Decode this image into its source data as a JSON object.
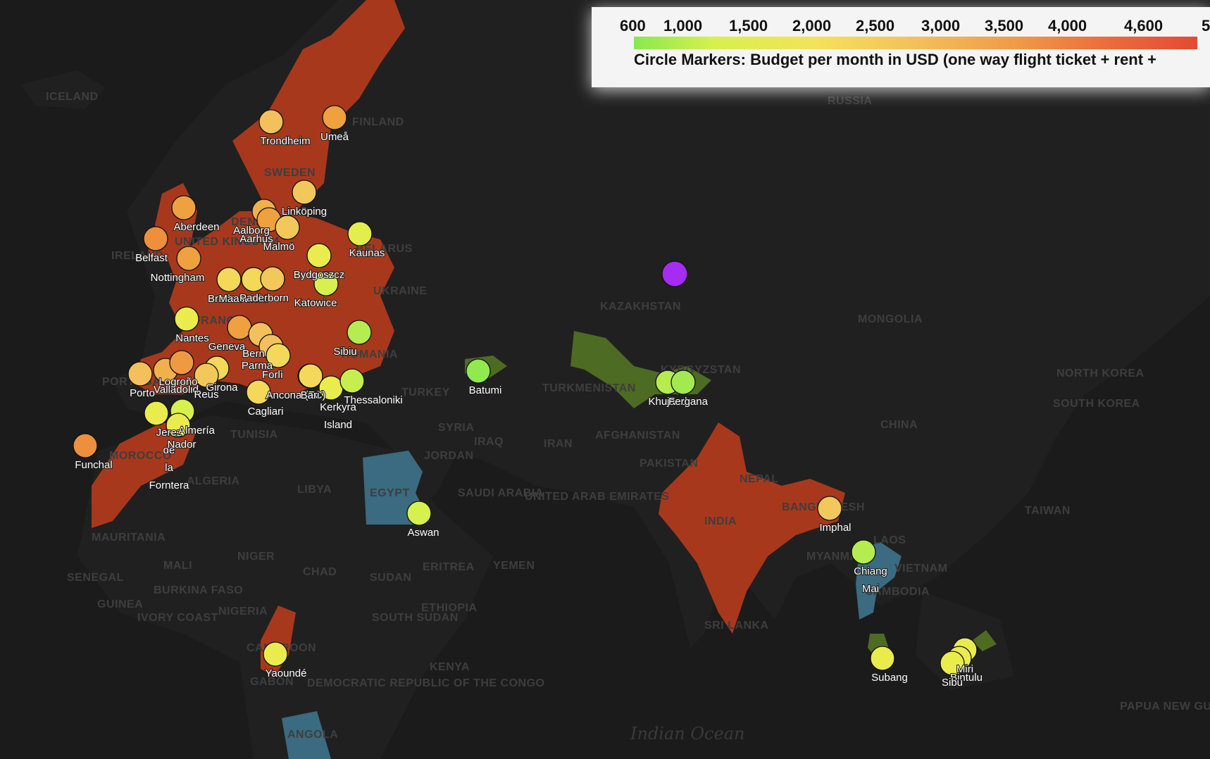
{
  "colors": {
    "background": "#1b1b1b",
    "land": "#1e1e1e",
    "high_budget_region": "#a8381c",
    "low_budget_region": "#4d6b22",
    "blue_region": "#3a6b80",
    "marker_green": "#92e94f",
    "marker_yellow": "#eaec4d",
    "marker_lightyellow": "#f3e35a",
    "marker_orange": "#efa13f",
    "marker_purple": "#a52cf0"
  },
  "legend": {
    "ticks": [
      "600",
      "1,000",
      "1,500",
      "2,000",
      "2,500",
      "3,000",
      "3,500",
      "4,000",
      "4,600",
      "5"
    ],
    "title": "Circle Markers: Budget per month in USD (one way flight ticket + rent +"
  },
  "countries": [
    "ICELAND",
    "FINLAND",
    "SWEDEN",
    "DENMARK",
    "IRELAND",
    "UNITED KINGDOM",
    "BELARUS",
    "UKRAINE",
    "FRANCE",
    "PORTUGAL",
    "ROMANIA",
    "TURKEY",
    "SYRIA",
    "IRAQ",
    "JORDAN",
    "IRAN",
    "TURKMENISTAN",
    "AFGHANISTAN",
    "PAKISTAN",
    "KAZAKHSTAN",
    "KYRGYZSTAN",
    "MONGOLIA",
    "CHINA",
    "RUSSIA",
    "NORTH KOREA",
    "SOUTH KOREA",
    "TAIWAN",
    "INDIA",
    "NEPAL",
    "BANGLADESH",
    "SRI LANKA",
    "MYANMAR",
    "LAOS",
    "VIETNAM",
    "CAMBODIA",
    "TUNISIA",
    "ALGERIA",
    "LIBYA",
    "EGYPT",
    "SAUDI ARABIA",
    "UNITED ARAB EMIRATES",
    "YEMEN",
    "ERITREA",
    "SUDAN",
    "SOUTH SUDAN",
    "ETHIOPIA",
    "KENYA",
    "CHAD",
    "NIGER",
    "MALI",
    "MAURITANIA",
    "SENEGAL",
    "GUINEA",
    "BURKINA FASO",
    "IVORY COAST",
    "NIGERIA",
    "CAMEROON",
    "GABON",
    "DEMOCRATIC REPUBLIC OF THE CONGO",
    "ANGOLA",
    "MOROCCO",
    "PAPUA NEW GUINEA"
  ],
  "seas": [
    "Indian Ocean"
  ],
  "cities": [
    {
      "name": "Trondheim",
      "color": "#f3c05c"
    },
    {
      "name": "Umeå",
      "color": "#efa13f"
    },
    {
      "name": "Linköping",
      "color": "#f3c85a"
    },
    {
      "name": "Aberdeen",
      "color": "#efa13f"
    },
    {
      "name": "Belfast",
      "color": "#ee8f3d"
    },
    {
      "name": "Aalborg",
      "color": "#f0b04c"
    },
    {
      "name": "Aarhus",
      "color": "#efa13f"
    },
    {
      "name": "Malmö",
      "color": "#f3c85a"
    },
    {
      "name": "Kaunas",
      "color": "#e3ee4d"
    },
    {
      "name": "Bydgoszcz",
      "color": "#eaec4d"
    },
    {
      "name": "Nottingham",
      "color": "#efa13f"
    },
    {
      "name": "Breda",
      "color": "#f3d85a"
    },
    {
      "name": "Maastricht",
      "color": "#f3d85a"
    },
    {
      "name": "Paderborn",
      "color": "#f3c85a"
    },
    {
      "name": "Katowice",
      "color": "#d6f04e"
    },
    {
      "name": "Nantes",
      "color": "#eaec4d"
    },
    {
      "name": "Geneva",
      "color": "#efa13f"
    },
    {
      "name": "Bern",
      "color": "#f3c05c"
    },
    {
      "name": "Parma",
      "color": "#f3c05c"
    },
    {
      "name": "Forlì",
      "color": "#f3d85a"
    },
    {
      "name": "Ancona (FC)",
      "color": "#f3d85a"
    },
    {
      "name": "Sibiu",
      "color": "#b5ec4f"
    },
    {
      "name": "Porto",
      "color": "#f3c05c"
    },
    {
      "name": "Valladolid",
      "color": "#f0b04c"
    },
    {
      "name": "Logroño",
      "color": "#ee9a42"
    },
    {
      "name": "Girona",
      "color": "#f3d85a"
    },
    {
      "name": "Reus",
      "color": "#f3c85a"
    },
    {
      "name": "Cagliari",
      "color": "#f3d85a"
    },
    {
      "name": "Bari",
      "color": "#f3d85a"
    },
    {
      "name": "Kerkyra Island",
      "color": "#eaec4d"
    },
    {
      "name": "Thessaloniki",
      "color": "#c6ee4f"
    },
    {
      "name": "Jerez de la Forntera",
      "color": "#eaec4d"
    },
    {
      "name": "Almería",
      "color": "#d6f04e"
    },
    {
      "name": "Nador",
      "color": "#eaec4d"
    },
    {
      "name": "Funchal",
      "color": "#ee8f3d"
    },
    {
      "name": "Batumi",
      "color": "#92e94f"
    },
    {
      "name": "Khujand",
      "color": "#b5ec4f"
    },
    {
      "name": "Fergana",
      "color": "#a2ea4f"
    },
    {
      "name": "Aswan",
      "color": "#d6f04e"
    },
    {
      "name": "Yaoundé",
      "color": "#eaec4d"
    },
    {
      "name": "Imphal",
      "color": "#f3c85a"
    },
    {
      "name": "Chiang Mai",
      "color": "#b5ec4f"
    },
    {
      "name": "Subang",
      "color": "#eaec4d"
    },
    {
      "name": "Miri",
      "color": "#eaec4d"
    },
    {
      "name": "Bintulu",
      "color": "#eaec4d"
    },
    {
      "name": "Sibu",
      "color": "#eaec4d"
    }
  ]
}
